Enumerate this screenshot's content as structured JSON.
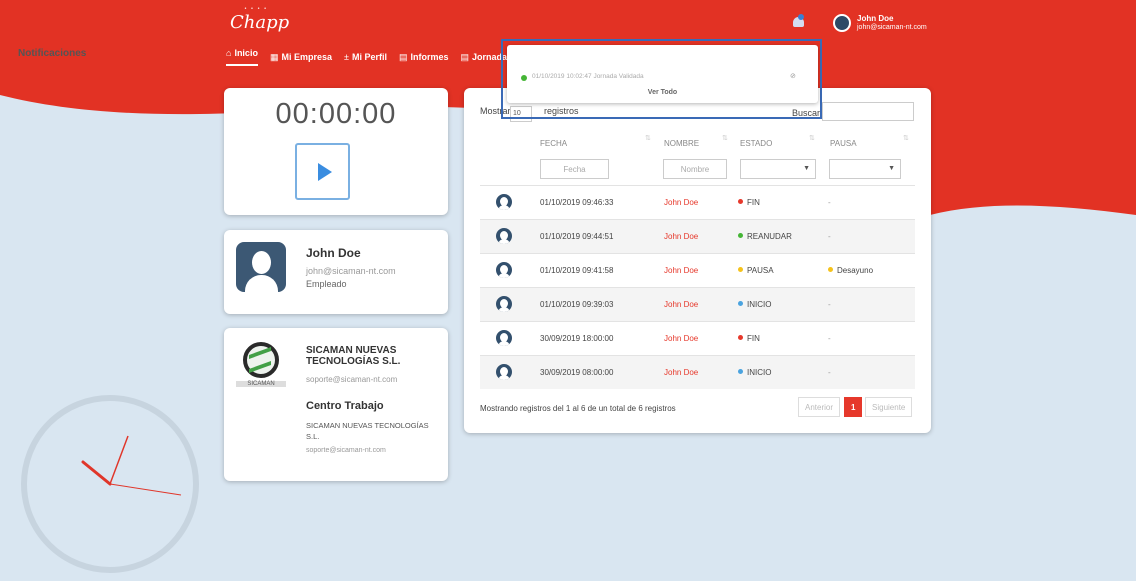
{
  "brand": {
    "logo_text": "Chapp",
    "logo_dots": "• • • •"
  },
  "colors": {
    "header_red": "#e23224",
    "accent_red": "#e6382b",
    "accent_blue": "#3a8de0",
    "page_bg": "#d9e6f1"
  },
  "nav": {
    "items": [
      {
        "icon": "home-icon",
        "glyph": "⌂",
        "label": "Inicio",
        "active": true
      },
      {
        "icon": "building-icon",
        "glyph": "▦",
        "label": "Mi Empresa"
      },
      {
        "icon": "user-icon",
        "glyph": "±",
        "label": "Mi Perfil"
      },
      {
        "icon": "document-icon",
        "glyph": "▤",
        "label": "Informes"
      },
      {
        "icon": "calendar-icon",
        "glyph": "▤",
        "label": "Jornadas"
      }
    ]
  },
  "header_user": {
    "name": "John Doe",
    "email": "john@sicaman-nt.com"
  },
  "notifications": {
    "title": "Notificaciones",
    "items": [
      {
        "text": "01/10/2019 10:02:47 Jornada Validada",
        "dismiss_icon": "eye-off-icon",
        "dismiss_glyph": "⊘"
      }
    ],
    "view_all": "Ver Todo"
  },
  "timer": {
    "value": "00:00:00"
  },
  "user_card": {
    "name": "John Doe",
    "email": "john@sicaman-nt.com",
    "role": "Empleado"
  },
  "company_card": {
    "logo_text": "SICAMAN",
    "name": "SICAMAN NUEVAS TECNOLOGÍAS S.L.",
    "email": "soporte@sicaman-nt.com",
    "center_heading": "Centro Trabajo",
    "center_name": "SICAMAN NUEVAS TECNOLOGÍAS S.L.",
    "center_email": "soporte@sicaman-nt.com"
  },
  "table": {
    "show_label": "Mostrar",
    "page_size": "10",
    "records_label": "registros",
    "search_label": "Buscar:",
    "columns": [
      "FECHA",
      "NOMBRE",
      "ESTADO",
      "PAUSA"
    ],
    "filters": {
      "fecha_placeholder": "Fecha",
      "nombre_placeholder": "Nombre",
      "estado_value": "",
      "pausa_value": ""
    },
    "rows": [
      {
        "fecha": "01/10/2019 09:46:33",
        "nombre": "John Doe",
        "estado": "FIN",
        "estado_color": "#e6382b",
        "pausa": "-",
        "pausa_color": ""
      },
      {
        "fecha": "01/10/2019 09:44:51",
        "nombre": "John Doe",
        "estado": "REANUDAR",
        "estado_color": "#45b536",
        "pausa": "-",
        "pausa_color": ""
      },
      {
        "fecha": "01/10/2019 09:41:58",
        "nombre": "John Doe",
        "estado": "PAUSA",
        "estado_color": "#f5c21b",
        "pausa": "Desayuno",
        "pausa_color": "#f5c21b"
      },
      {
        "fecha": "01/10/2019 09:39:03",
        "nombre": "John Doe",
        "estado": "INICIO",
        "estado_color": "#4aa3df",
        "pausa": "-",
        "pausa_color": ""
      },
      {
        "fecha": "30/09/2019 18:00:00",
        "nombre": "John Doe",
        "estado": "FIN",
        "estado_color": "#e6382b",
        "pausa": "-",
        "pausa_color": ""
      },
      {
        "fecha": "30/09/2019 08:00:00",
        "nombre": "John Doe",
        "estado": "INICIO",
        "estado_color": "#4aa3df",
        "pausa": "-",
        "pausa_color": ""
      }
    ],
    "info": "Mostrando registros del 1 al 6 de un total de 6 registros",
    "pagination": {
      "prev": "Anterior",
      "current": "1",
      "next": "Siguiente"
    }
  }
}
